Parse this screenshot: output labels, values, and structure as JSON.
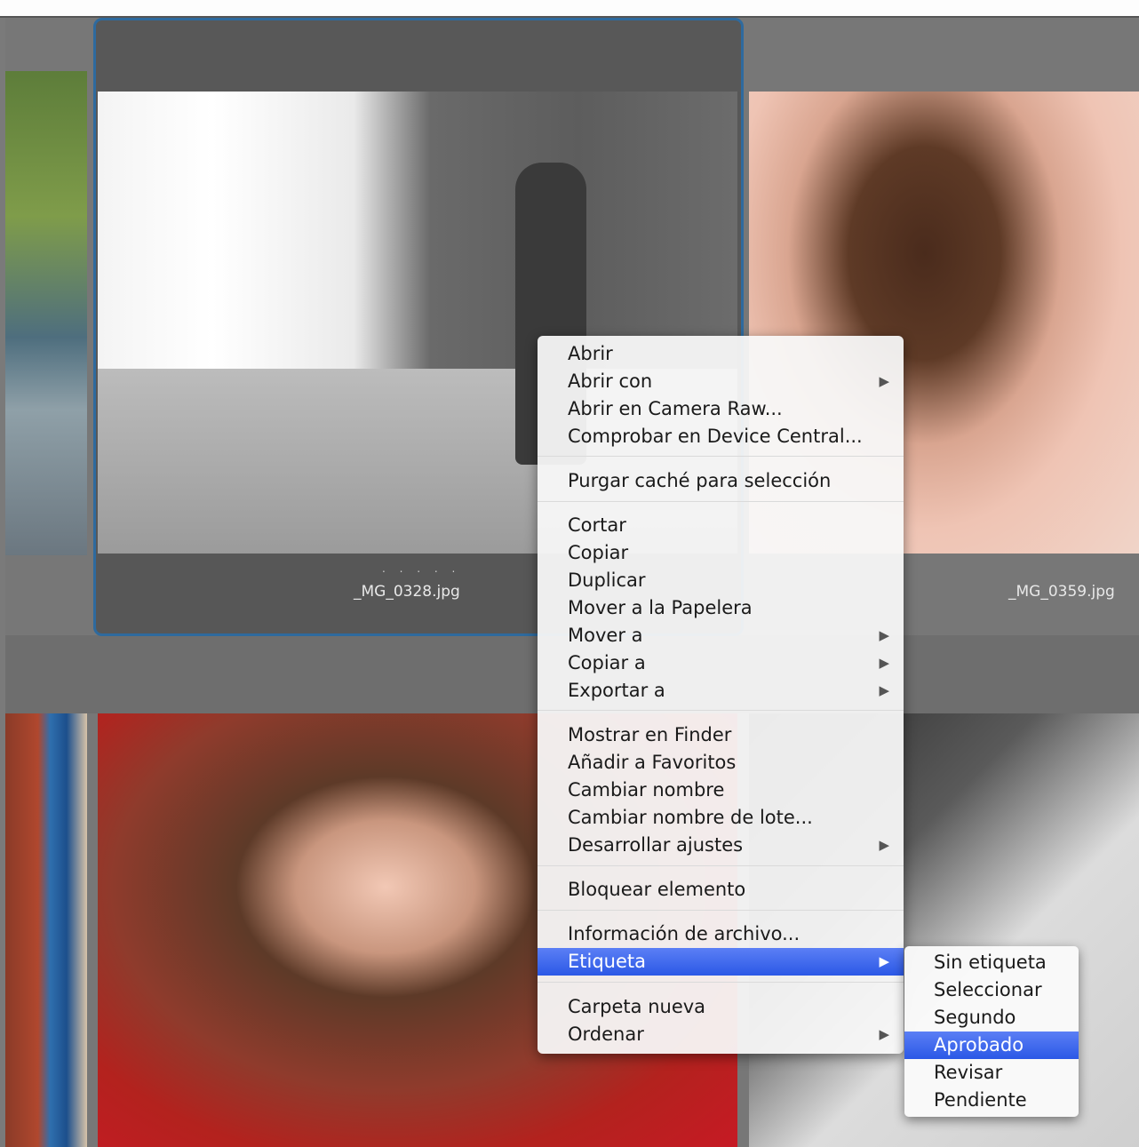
{
  "thumbnails": {
    "selected_caption": "_MG_0328.jpg",
    "selected_rating": ". . . . .",
    "right_caption": "_MG_0359.jpg"
  },
  "context_menu": {
    "items": [
      {
        "label": "Abrir",
        "submenu": false
      },
      {
        "label": "Abrir con",
        "submenu": true
      },
      {
        "label": "Abrir en Camera Raw...",
        "submenu": false
      },
      {
        "label": "Comprobar en Device Central...",
        "submenu": false
      },
      {
        "label": "Purgar caché para selección",
        "submenu": false
      },
      {
        "label": "Cortar",
        "submenu": false
      },
      {
        "label": "Copiar",
        "submenu": false
      },
      {
        "label": "Duplicar",
        "submenu": false
      },
      {
        "label": "Mover a la Papelera",
        "submenu": false
      },
      {
        "label": "Mover a",
        "submenu": true
      },
      {
        "label": "Copiar a",
        "submenu": true
      },
      {
        "label": "Exportar a",
        "submenu": true
      },
      {
        "label": "Mostrar en Finder",
        "submenu": false
      },
      {
        "label": "Añadir a Favoritos",
        "submenu": false
      },
      {
        "label": "Cambiar nombre",
        "submenu": false
      },
      {
        "label": "Cambiar nombre de lote...",
        "submenu": false
      },
      {
        "label": "Desarrollar ajustes",
        "submenu": true
      },
      {
        "label": "Bloquear elemento",
        "submenu": false
      },
      {
        "label": "Información de archivo...",
        "submenu": false
      },
      {
        "label": "Etiqueta",
        "submenu": true,
        "highlighted": true
      },
      {
        "label": "Carpeta nueva",
        "submenu": false
      },
      {
        "label": "Ordenar",
        "submenu": true
      }
    ],
    "arrow_glyph": "▶"
  },
  "label_submenu": {
    "items": [
      {
        "label": "Sin etiqueta"
      },
      {
        "label": "Seleccionar"
      },
      {
        "label": "Segundo"
      },
      {
        "label": "Aprobado",
        "highlighted": true
      },
      {
        "label": "Revisar"
      },
      {
        "label": "Pendiente"
      }
    ]
  },
  "colors": {
    "highlight": "#2b58e6",
    "selection_border": "#2e6a9e"
  }
}
